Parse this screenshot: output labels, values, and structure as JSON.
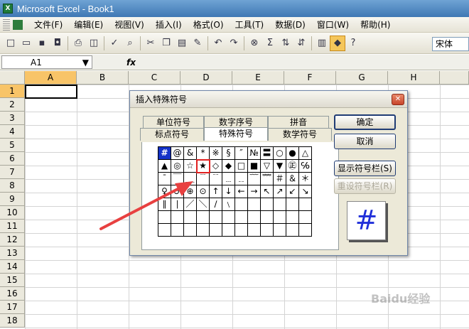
{
  "window": {
    "title": "Microsoft Excel - Book1"
  },
  "menu": [
    "文件(F)",
    "编辑(E)",
    "视图(V)",
    "插入(I)",
    "格式(O)",
    "工具(T)",
    "数据(D)",
    "窗口(W)",
    "帮助(H)"
  ],
  "toolbar": {
    "font": "宋体",
    "fx": "fx"
  },
  "namebox": "A1",
  "columns": [
    "A",
    "B",
    "C",
    "D",
    "E",
    "F",
    "G",
    "H"
  ],
  "rows": [
    "1",
    "2",
    "3",
    "4",
    "5",
    "6",
    "7",
    "8",
    "9",
    "10",
    "11",
    "12",
    "13",
    "14",
    "15",
    "16",
    "17",
    "18"
  ],
  "dialog": {
    "title": "插入特殊符号",
    "tabs": {
      "unit": "单位符号",
      "numeric": "数字序号",
      "pinyin": "拼音",
      "punct": "标点符号",
      "special": "特殊符号",
      "math": "数学符号"
    },
    "buttons": {
      "ok": "确定",
      "cancel": "取消",
      "show_bar": "显示符号栏(S)",
      "reset_bar": "重设符号栏(R)"
    },
    "symbols": [
      [
        "#",
        "@",
        "&",
        "*",
        "※",
        "§",
        "″",
        "№",
        "〓",
        "○",
        "●",
        "△"
      ],
      [
        "▲",
        "◎",
        "☆",
        "★",
        "◇",
        "◆",
        "□",
        "■",
        "▽",
        "▼",
        "㊣",
        "℅"
      ],
      [
        "ˉ",
        "￣",
        "＿",
        "﹉",
        "﹊",
        "﹍",
        "﹎",
        "﹋",
        "﹌",
        "＃",
        "＆",
        "＊"
      ],
      [
        "♀",
        "♂",
        "⊕",
        "⊙",
        "↑",
        "↓",
        "←",
        "→",
        "↖",
        "↗",
        "↙",
        "↘"
      ],
      [
        "∥",
        "∣",
        "／",
        "＼",
        "∕",
        "﹨",
        "",
        "",
        "",
        "",
        "",
        ""
      ],
      [
        "",
        "",
        "",
        "",
        "",
        "",
        "",
        "",
        "",
        "",
        "",
        ""
      ],
      [
        "",
        "",
        "",
        "",
        "",
        "",
        "",
        "",
        "",
        "",
        "",
        ""
      ]
    ],
    "preview": "#"
  },
  "watermark": "Baidu经验"
}
